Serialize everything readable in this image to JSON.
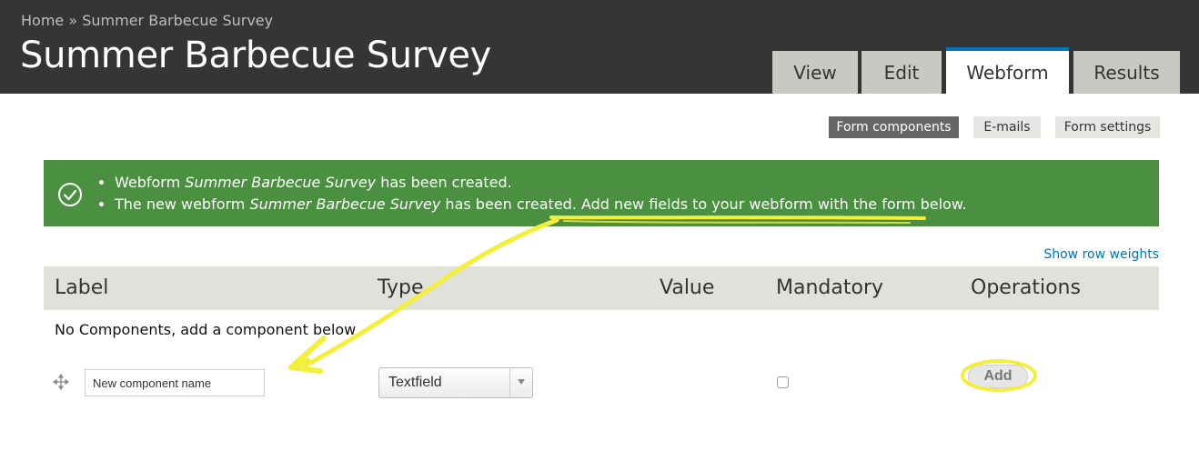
{
  "header": {
    "breadcrumb": {
      "home": "Home",
      "separator": "»",
      "current": "Summer Barbecue Survey"
    },
    "title": "Summer Barbecue Survey",
    "tabs": [
      {
        "label": "View",
        "active": false
      },
      {
        "label": "Edit",
        "active": false
      },
      {
        "label": "Webform",
        "active": true
      },
      {
        "label": "Results",
        "active": false
      }
    ]
  },
  "subtabs": [
    {
      "label": "Form components",
      "active": true
    },
    {
      "label": "E-mails",
      "active": false
    },
    {
      "label": "Form settings",
      "active": false
    }
  ],
  "messages": {
    "status_color": "#4a9040",
    "icon": "check-circle-icon",
    "items": [
      {
        "before": "Webform ",
        "emphasis": "Summer Barbecue Survey",
        "after": " has been created."
      },
      {
        "before": "The new webform ",
        "emphasis": "Summer Barbecue Survey",
        "after": " has been created. Add new fields to your webform with the form below."
      }
    ]
  },
  "table": {
    "show_row_weights": "Show row weights",
    "columns": [
      "Label",
      "Type",
      "Value",
      "Mandatory",
      "Operations"
    ],
    "empty_message": "No Components, add a component below",
    "new_row": {
      "name_placeholder": "New component name",
      "type_selected": "Textfield",
      "mandatory_checked": false,
      "add_label": "Add"
    }
  },
  "colors": {
    "header_bg": "#353535",
    "active_tab_border": "#0074bd",
    "link": "#0074bd",
    "annotation": "#f4ee3c"
  }
}
